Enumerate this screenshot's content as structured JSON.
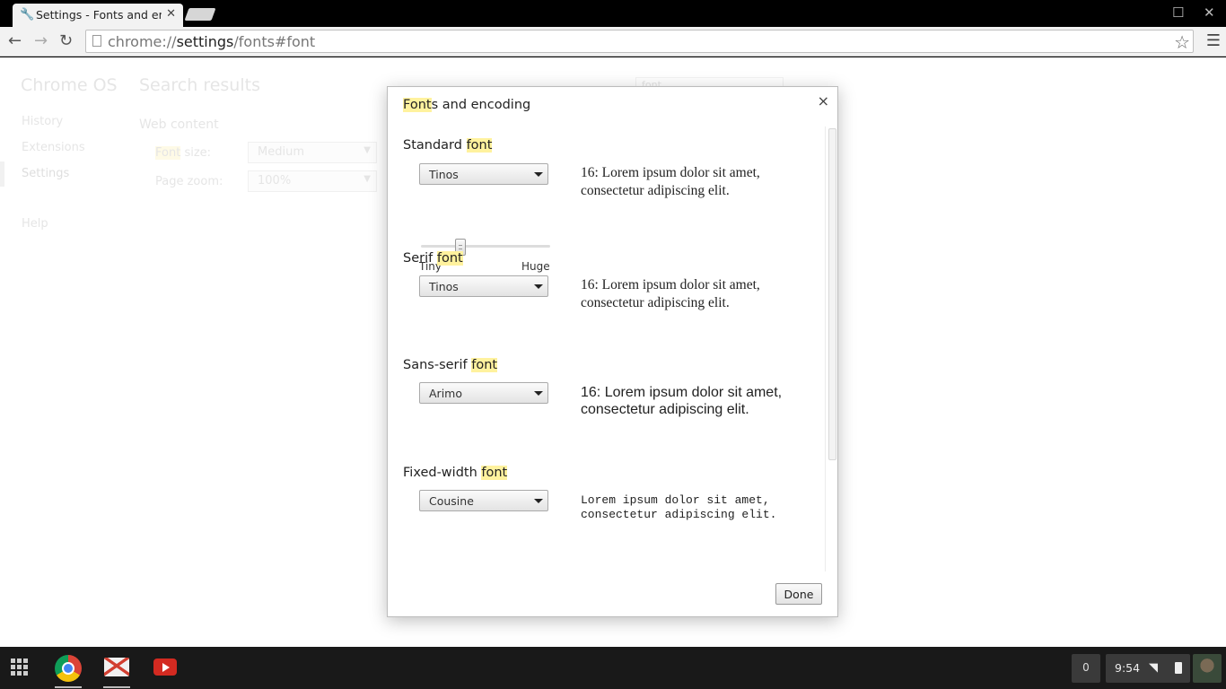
{
  "browser": {
    "tab_title": "Settings - Fonts and enc",
    "url_scheme": "chrome://",
    "url_host": "settings",
    "url_path": "/fonts#font"
  },
  "background_page": {
    "sidebar": {
      "title": "Chrome OS",
      "items": [
        "History",
        "Extensions",
        "Settings",
        "Help"
      ]
    },
    "main_title": "Search results",
    "search_value": "font",
    "section": "Web content",
    "rows": [
      {
        "label_highlight": "Font",
        "label_rest": " size:",
        "value": "Medium"
      },
      {
        "label_highlight": "",
        "label_rest": "Page zoom:",
        "value": "100%"
      }
    ]
  },
  "dialog": {
    "title_highlight": "Font",
    "title_rest": "s and encoding",
    "close": "×",
    "sections": [
      {
        "label": "Standard ",
        "label_highlight": "font",
        "select_value": "Tinos",
        "sample": "16: Lorem ipsum dolor sit amet, consectetur adipiscing elit."
      },
      {
        "label": "Serif ",
        "label_highlight": "font",
        "select_value": "Tinos",
        "sample": "16: Lorem ipsum dolor sit amet, consectetur adipiscing elit."
      },
      {
        "label": "Sans-serif ",
        "label_highlight": "font",
        "select_value": "Arimo",
        "sample": "16: Lorem ipsum dolor sit amet, consectetur adipiscing elit."
      },
      {
        "label": "Fixed-width ",
        "label_highlight": "font",
        "select_value": "Cousine",
        "sample": "Lorem ipsum dolor sit amet, consectetur adipiscing elit."
      }
    ],
    "slider": {
      "min_label": "Tiny",
      "max_label": "Huge"
    },
    "done_label": "Done"
  },
  "shelf": {
    "notification_count": "0",
    "clock": "9:54",
    "apps": [
      "chrome-icon",
      "gmail-icon",
      "youtube-icon"
    ]
  },
  "colors": {
    "highlight": "#fff29e",
    "shelf": "#191919"
  }
}
